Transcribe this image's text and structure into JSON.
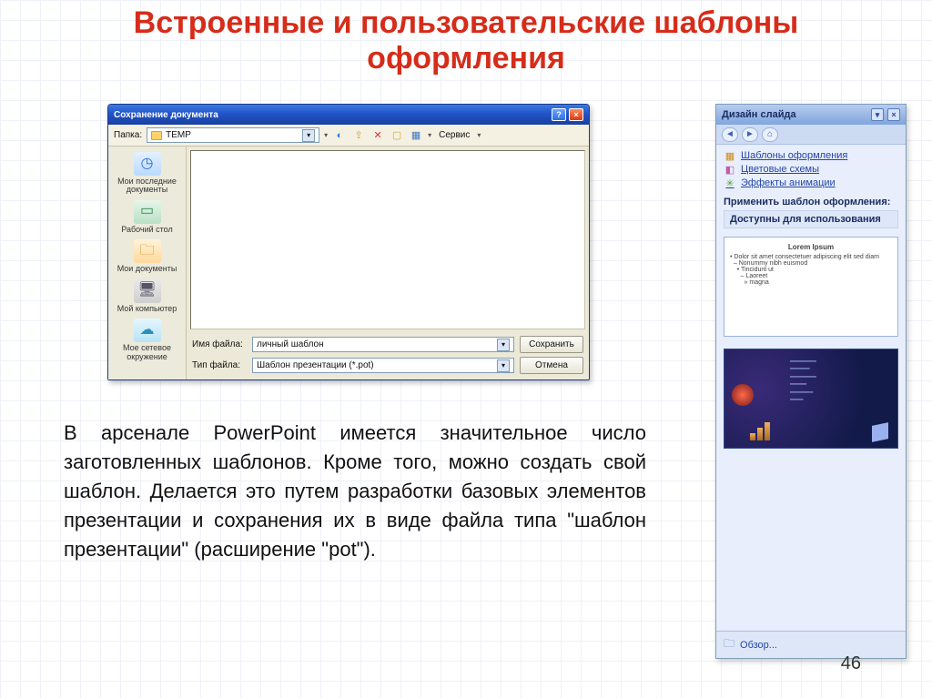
{
  "slide": {
    "title": "Встроенные и пользовательские шаблоны оформления",
    "page_number": "46",
    "body_text": "В арсенале PowerPoint имеется значительное число заготовленных шаблонов. Кроме того, можно создать свой шаблон. Делается это путем разработки базовых элементов презентации и сохранения их в виде файла типа \"шаблон презентации\" (расширение \"pot\")."
  },
  "dialog": {
    "title": "Сохранение документа",
    "folder_label": "Папка:",
    "folder_value": "TEMP",
    "tools_label": "Сервис",
    "places": [
      {
        "label": "Мои последние документы"
      },
      {
        "label": "Рабочий стол"
      },
      {
        "label": "Мои документы"
      },
      {
        "label": "Мой компьютер"
      },
      {
        "label": "Мое сетевое окружение"
      }
    ],
    "filename_label": "Имя файла:",
    "filename_value": "личный шаблон",
    "filetype_label": "Тип файла:",
    "filetype_value": "Шаблон презентации (*.pot)",
    "save_btn": "Сохранить",
    "cancel_btn": "Отмена"
  },
  "pane": {
    "title": "Дизайн слайда",
    "links": {
      "templates": "Шаблоны оформления",
      "colors": "Цветовые схемы",
      "anim": "Эффекты анимации"
    },
    "apply_label": "Применить шаблон оформления:",
    "group_available": "Доступны для использования",
    "thumb1_title": "Lorem Ipsum",
    "browse": "Обзор..."
  }
}
